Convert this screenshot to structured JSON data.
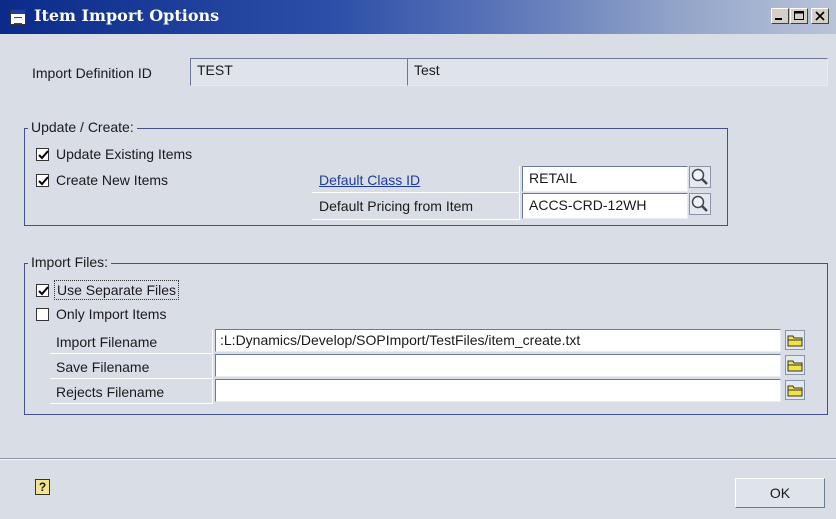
{
  "window": {
    "title": "Item Import Options"
  },
  "definition": {
    "label": "Import Definition ID",
    "id": "TEST",
    "description": "Test"
  },
  "update_create": {
    "group_label": "Update / Create:",
    "update_existing": {
      "label": "Update Existing Items",
      "checked": true
    },
    "create_new": {
      "label": "Create New Items",
      "checked": true
    },
    "default_class": {
      "label": "Default Class ID",
      "value": "RETAIL"
    },
    "default_pricing": {
      "label": "Default Pricing from Item",
      "value": "ACCS-CRD-12WH"
    }
  },
  "import_files": {
    "group_label": "Import Files:",
    "use_separate": {
      "label": "Use Separate Files",
      "checked": true
    },
    "only_import": {
      "label": "Only Import Items",
      "checked": false
    },
    "import_filename": {
      "label": "Import Filename",
      "value": ":L:Dynamics/Develop/SOPImport/TestFiles/item_create.txt"
    },
    "save_filename": {
      "label": "Save Filename",
      "value": ""
    },
    "rejects_filename": {
      "label": "Rejects Filename",
      "value": ""
    }
  },
  "footer": {
    "ok_label": "OK"
  }
}
